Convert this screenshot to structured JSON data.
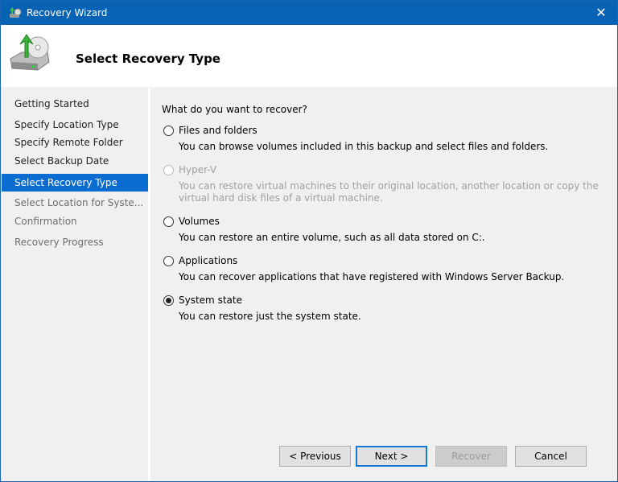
{
  "window": {
    "title": "Recovery Wizard",
    "close": "✕"
  },
  "header": {
    "title": "Select Recovery Type"
  },
  "steps": [
    {
      "label": "Getting Started",
      "state": "done"
    },
    {
      "label": "Specify Location Type",
      "state": "done"
    },
    {
      "label": "Specify Remote Folder",
      "state": "done"
    },
    {
      "label": "Select Backup Date",
      "state": "done"
    },
    {
      "label": "Select Recovery Type",
      "state": "current"
    },
    {
      "label": "Select Location for Syste...",
      "state": "pending"
    },
    {
      "label": "Confirmation",
      "state": "pending"
    },
    {
      "label": "Recovery Progress",
      "state": "pending"
    }
  ],
  "main": {
    "question": "What do you want to recover?",
    "options": [
      {
        "label": "Files and folders",
        "desc": "You can browse volumes included in this backup and select files and folders.",
        "selected": false,
        "enabled": true
      },
      {
        "label": "Hyper-V",
        "desc": "You can restore virtual machines to their original location, another location or copy the virtual hard disk files of a virtual machine.",
        "selected": false,
        "enabled": false
      },
      {
        "label": "Volumes",
        "desc": "You can restore an entire volume, such as all data stored on C:.",
        "selected": false,
        "enabled": true
      },
      {
        "label": "Applications",
        "desc": "You can recover applications that have registered with Windows Server Backup.",
        "selected": false,
        "enabled": true
      },
      {
        "label": "System state",
        "desc": "You can restore just the system state.",
        "selected": true,
        "enabled": true
      }
    ]
  },
  "buttons": {
    "previous": "< Previous",
    "next": "Next >",
    "recover": "Recover",
    "cancel": "Cancel"
  }
}
